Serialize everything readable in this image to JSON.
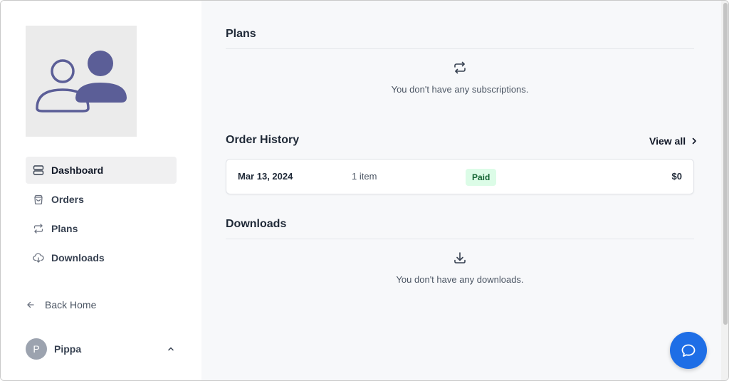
{
  "sidebar": {
    "nav": [
      {
        "label": "Dashboard",
        "icon": "dashboard-icon",
        "active": true
      },
      {
        "label": "Orders",
        "icon": "bag-icon",
        "active": false
      },
      {
        "label": "Plans",
        "icon": "repeat-icon",
        "active": false
      },
      {
        "label": "Downloads",
        "icon": "cloud-download-icon",
        "active": false
      }
    ],
    "back_home": "Back Home",
    "user": {
      "initial": "P",
      "name": "Pippa"
    }
  },
  "main": {
    "plans": {
      "title": "Plans",
      "empty_text": "You don't have any subscriptions."
    },
    "order_history": {
      "title": "Order History",
      "view_all": "View all",
      "orders": [
        {
          "date": "Mar 13, 2024",
          "items": "1 item",
          "status": "Paid",
          "total": "$0"
        }
      ]
    },
    "downloads": {
      "title": "Downloads",
      "empty_text": "You don't have any downloads."
    }
  },
  "colors": {
    "accent": "#1e6ee6",
    "badge_bg": "#dcfce7",
    "badge_text": "#166534",
    "avatar_icon": "#5b5e97"
  }
}
